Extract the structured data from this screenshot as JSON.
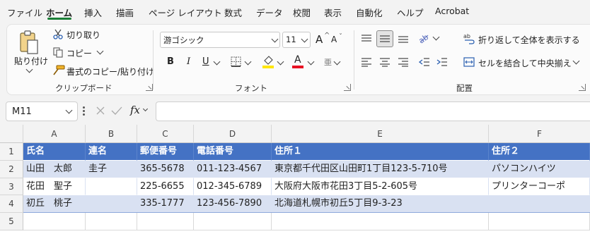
{
  "menu": {
    "tabs": [
      "ファイル",
      "ホーム",
      "挿入",
      "描画",
      "ページ レイアウト",
      "数式",
      "データ",
      "校閲",
      "表示",
      "自動化",
      "ヘルプ",
      "Acrobat"
    ],
    "active": "ホーム"
  },
  "clipboard": {
    "paste": "貼り付け",
    "cut": "切り取り",
    "copy": "コピー",
    "format_painter": "書式のコピー/貼り付け",
    "label": "クリップボード"
  },
  "font": {
    "name": "游ゴシック",
    "size": "11",
    "bold": "B",
    "italic": "I",
    "underline": "U",
    "grow": "A",
    "shrink": "A",
    "font_color": "A",
    "phonetic": "亜",
    "label": "フォント",
    "highlight_color": "#ffe600",
    "font_color_bar": "#e81123"
  },
  "alignment": {
    "wrap_text": "折り返して全体を表示する",
    "merge_center": "セルを結合して中央揃え",
    "label": "配置"
  },
  "formula_bar": {
    "name_box": "M11",
    "fx": "fx",
    "value": ""
  },
  "sheet": {
    "columns": [
      "A",
      "B",
      "C",
      "D",
      "E",
      "F"
    ],
    "rows": [
      "1",
      "2",
      "3",
      "4",
      "5"
    ],
    "header": [
      "氏名",
      "連名",
      "郵便番号",
      "電話番号",
      "住所１",
      "住所２"
    ],
    "data": [
      [
        "山田　太郎",
        "圭子",
        "365-5678",
        "011-123-4567",
        "東京都千代田区山田町1丁目123-5-710号",
        "パソコンハイツ"
      ],
      [
        "花田　聖子",
        "",
        "225-6655",
        "012-345-6789",
        "大阪府大阪市花田3丁目5-2-605号",
        "プリンターコーポ"
      ],
      [
        "初丘　桃子",
        "",
        "335-1777",
        "123-456-7890",
        "北海道札幌市初丘5丁目9-3-23",
        ""
      ]
    ],
    "table_header_color": "#4472c4",
    "band_color": "#d9e1f2"
  }
}
